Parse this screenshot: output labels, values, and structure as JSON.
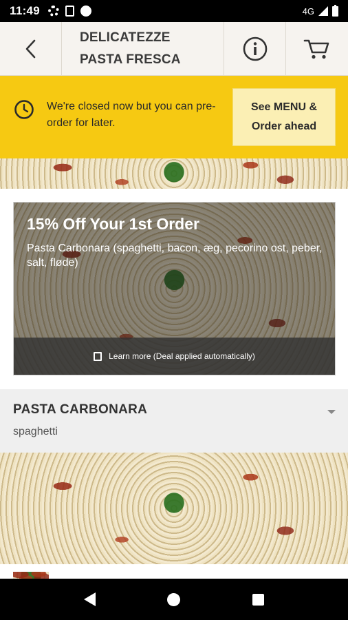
{
  "status_bar": {
    "time": "11:49",
    "network": "4G",
    "icons": [
      "gear-icon",
      "clipboard-icon",
      "chat-icon",
      "signal-icon",
      "battery-icon"
    ]
  },
  "header": {
    "title_line1": "DELICATEZZE",
    "title_line2": "PASTA FRESCA",
    "icons": [
      "back-arrow-icon",
      "info-icon",
      "cart-icon"
    ]
  },
  "closed_banner": {
    "message": "We're closed now but you can pre-order for later.",
    "button_label": "See MENU &\nOrder ahead",
    "icon": "clock-icon",
    "color": "#f6c912"
  },
  "deal": {
    "title": "15% Off Your 1st Order",
    "description": "Pasta Carbonara (spaghetti, bacon, æg, pecorino ost, peber, salt, fløde)",
    "footer": "Learn more (Deal applied automatically)",
    "icon": "tag-icon"
  },
  "category": {
    "title": "PASTA CARBONARA",
    "subtitle": "spaghetti",
    "icon": "caret-down-icon"
  },
  "nav_bar": {
    "icons": [
      "nav-back-icon",
      "nav-home-icon",
      "nav-recents-icon"
    ]
  }
}
